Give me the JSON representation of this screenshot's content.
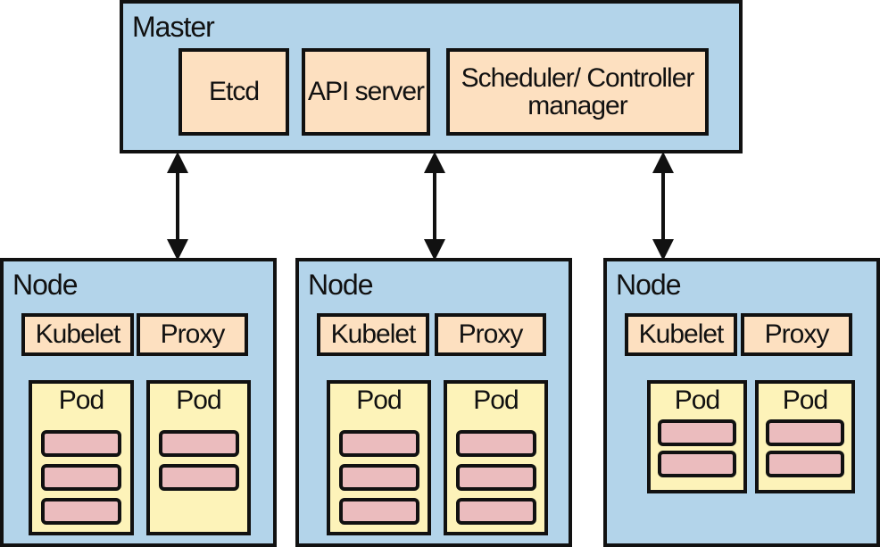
{
  "master": {
    "title": "Master",
    "components": [
      "Etcd",
      "API server",
      "Scheduler/ Controller manager"
    ]
  },
  "nodes": [
    {
      "title": "Node",
      "kubelet": "Kubelet",
      "proxy": "Proxy",
      "pods": [
        {
          "label": "Pod",
          "containers": 3
        },
        {
          "label": "Pod",
          "containers": 2
        }
      ]
    },
    {
      "title": "Node",
      "kubelet": "Kubelet",
      "proxy": "Proxy",
      "pods": [
        {
          "label": "Pod",
          "containers": 3
        },
        {
          "label": "Pod",
          "containers": 3
        }
      ]
    },
    {
      "title": "Node",
      "kubelet": "Kubelet",
      "proxy": "Proxy",
      "pods": [
        {
          "label": "Pod",
          "containers": 2
        },
        {
          "label": "Pod",
          "containers": 2
        }
      ]
    }
  ],
  "colors": {
    "cluster_bg": "#b3d4ea",
    "component_bg": "#fde0c0",
    "pod_bg": "#fdf3b9",
    "container_bg": "#ebbcbe",
    "stroke": "#111111"
  }
}
